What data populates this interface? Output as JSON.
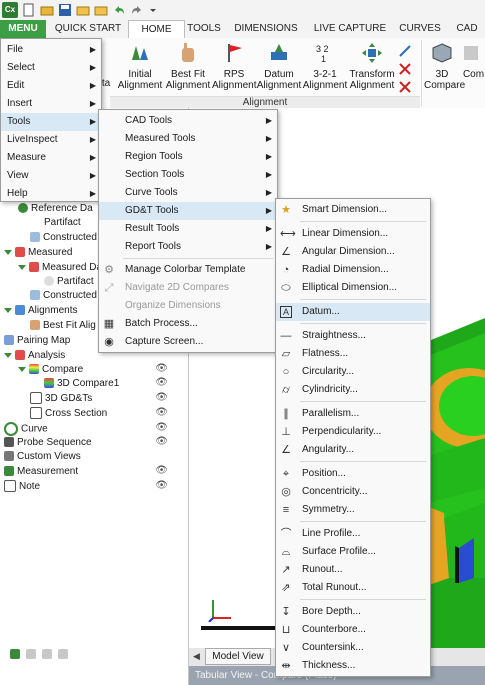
{
  "quick_access": {
    "logo": "Cx"
  },
  "tabs": [
    "MENU",
    "QUICK START",
    "HOME",
    "TOOLS",
    "DIMENSIONS",
    "LIVE CAPTURE",
    "CURVES",
    "CAD"
  ],
  "ribbon": {
    "buttons": [
      {
        "label1": "Initial",
        "label2": "Alignment"
      },
      {
        "label1": "Best Fit",
        "label2": "Alignment"
      },
      {
        "label1": "RPS",
        "label2": "Alignment"
      },
      {
        "label1": "Datum",
        "label2": "Alignment"
      },
      {
        "label1": "3-2-1",
        "label2": "Alignment"
      },
      {
        "label1": "Transform",
        "label2": "Alignment"
      },
      {
        "label1": "3D",
        "label2": "Compare"
      },
      {
        "label1": "",
        "label2": "Com"
      }
    ],
    "partial_label": "ta",
    "group_label": "Alignment"
  },
  "main_menu": {
    "items": [
      "File",
      "Select",
      "Edit",
      "Insert",
      "Tools",
      "LiveInspect",
      "Measure",
      "View",
      "Help"
    ]
  },
  "tools_menu": {
    "items": [
      "CAD Tools",
      "Measured Tools",
      "Region Tools",
      "Section Tools",
      "Curve Tools",
      "GD&T Tools",
      "Result Tools",
      "Report Tools",
      "Manage Colorbar Template",
      "Navigate 2D Compares",
      "Organize Dimensions",
      "Batch Process...",
      "Capture Screen..."
    ]
  },
  "gdt_menu": {
    "items": [
      "Smart Dimension...",
      "Linear Dimension...",
      "Angular Dimension...",
      "Radial Dimension...",
      "Elliptical Dimension...",
      "Datum...",
      "Straightness...",
      "Flatness...",
      "Circularity...",
      "Cylindricity...",
      "Parallelism...",
      "Perpendicularity...",
      "Angularity...",
      "Position...",
      "Concentricity...",
      "Symmetry...",
      "Line Profile...",
      "Surface Profile...",
      "Runout...",
      "Total Runout...",
      "Bore Depth...",
      "Counterbore...",
      "Countersink...",
      "Thickness..."
    ]
  },
  "tree": {
    "rows": [
      "Reference Da",
      "Partifact",
      "Constructed",
      "Measured",
      "Measured Da",
      "Partifact",
      "Constructed",
      "Alignments",
      "Best Fit Alig",
      "Pairing Map",
      "Analysis",
      "Compare",
      "3D Compare1",
      "3D GD&Ts",
      "Cross Section",
      "Curve",
      "Probe Sequence",
      "Custom Views",
      "Measurement",
      "Note"
    ]
  },
  "viewport": {
    "tab_label": "Model View",
    "status_text": "Tabular View - Compare (Place)"
  },
  "colors": {
    "accent_green": "#3c9f45",
    "model_green": "#22c51a",
    "highlight_blue": "#d8e8f5"
  }
}
